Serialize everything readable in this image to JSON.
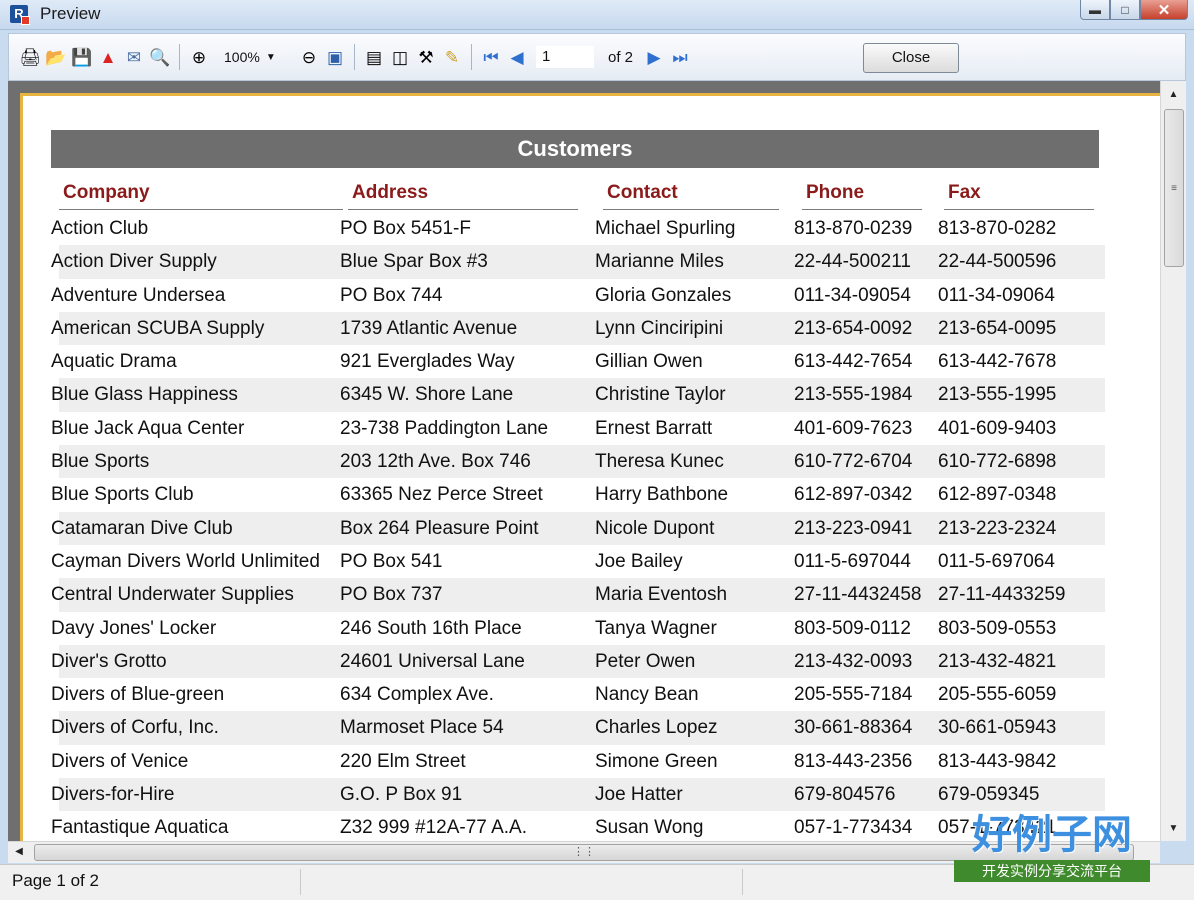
{
  "window": {
    "title": "Preview"
  },
  "toolbar": {
    "icons": [
      "print-icon",
      "open-icon",
      "save-icon",
      "pdf-icon",
      "email-icon",
      "find-icon",
      "zoom-in-icon",
      "zoom-out-icon",
      "fullscreen-icon",
      "outline-icon",
      "thumbnails-icon",
      "page-setup-icon",
      "edit-icon",
      "first-page-icon",
      "prev-page-icon",
      "next-page-icon",
      "last-page-icon"
    ],
    "zoom": "100%",
    "page_number": "1",
    "page_of": "of 2",
    "close_label": "Close"
  },
  "report": {
    "title": "Customers",
    "columns": [
      "Company",
      "Address",
      "Contact",
      "Phone",
      "Fax"
    ],
    "rows": [
      [
        "Action Club",
        "PO Box 5451-F",
        "Michael Spurling",
        "813-870-0239",
        "813-870-0282"
      ],
      [
        "Action Diver Supply",
        "Blue Spar Box #3",
        "Marianne Miles",
        "22-44-500211",
        "22-44-500596"
      ],
      [
        "Adventure Undersea",
        "PO Box 744",
        "Gloria Gonzales",
        "011-34-09054",
        "011-34-09064"
      ],
      [
        "American SCUBA Supply",
        "1739 Atlantic Avenue",
        "Lynn Cinciripini",
        "213-654-0092",
        "213-654-0095"
      ],
      [
        "Aquatic Drama",
        "921 Everglades Way",
        "Gillian Owen",
        "613-442-7654",
        "613-442-7678"
      ],
      [
        "Blue Glass Happiness",
        "6345 W. Shore Lane",
        "Christine Taylor",
        "213-555-1984",
        "213-555-1995"
      ],
      [
        "Blue Jack Aqua Center",
        "23-738 Paddington Lane",
        "Ernest Barratt",
        "401-609-7623",
        "401-609-9403"
      ],
      [
        "Blue Sports",
        "203 12th Ave. Box 746",
        "Theresa Kunec",
        "610-772-6704",
        "610-772-6898"
      ],
      [
        "Blue Sports Club",
        "63365 Nez Perce Street",
        "Harry Bathbone",
        "612-897-0342",
        "612-897-0348"
      ],
      [
        "Catamaran Dive Club",
        "Box 264 Pleasure Point",
        "Nicole Dupont",
        "213-223-0941",
        "213-223-2324"
      ],
      [
        "Cayman Divers World Unlimited",
        "PO Box 541",
        "Joe Bailey",
        "011-5-697044",
        "011-5-697064"
      ],
      [
        "Central Underwater Supplies",
        "PO Box 737",
        "Maria Eventosh",
        "27-11-4432458",
        "27-11-4433259"
      ],
      [
        "Davy Jones' Locker",
        "246 South 16th Place",
        "Tanya Wagner",
        "803-509-0112",
        "803-509-0553"
      ],
      [
        "Diver's Grotto",
        "24601 Universal Lane",
        "Peter Owen",
        "213-432-0093",
        "213-432-4821"
      ],
      [
        "Divers of Blue-green",
        "634 Complex Ave.",
        "Nancy Bean",
        "205-555-7184",
        "205-555-6059"
      ],
      [
        "Divers of Corfu, Inc.",
        "Marmoset Place 54",
        "Charles Lopez",
        "30-661-88364",
        "30-661-05943"
      ],
      [
        "Divers of Venice",
        "220 Elm Street",
        "Simone Green",
        "813-443-2356",
        "813-443-9842"
      ],
      [
        "Divers-for-Hire",
        "G.O. P Box 91",
        "Joe Hatter",
        "679-804576",
        "679-059345"
      ],
      [
        "Fantastique Aquatica",
        "Z32 999 #12A-77 A.A.",
        "Susan Wong",
        "057-1-773434",
        "057-1-773421"
      ]
    ]
  },
  "status": {
    "page_text": "Page 1 of 2"
  },
  "branding": {
    "main": "好例子网",
    "sub": "开发实例分享交流平台"
  }
}
